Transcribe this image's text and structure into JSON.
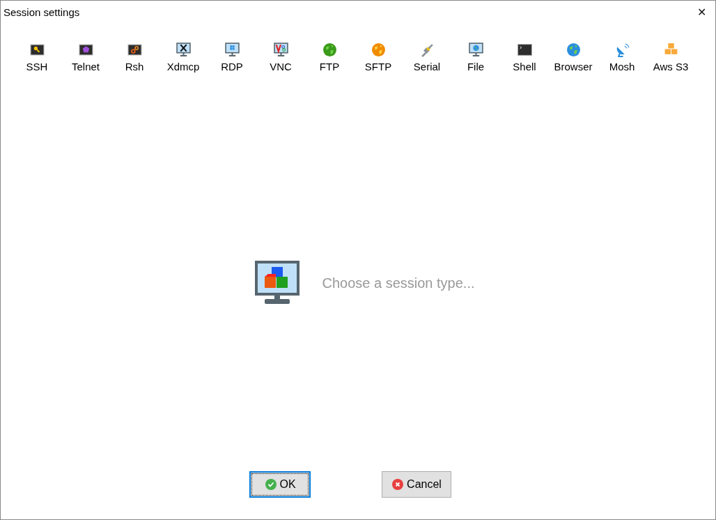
{
  "window": {
    "title": "Session settings",
    "close": "✕"
  },
  "session_types": [
    {
      "label": "SSH",
      "kind": "key"
    },
    {
      "label": "Telnet",
      "kind": "gem"
    },
    {
      "label": "Rsh",
      "kind": "gears"
    },
    {
      "label": "Xdmcp",
      "kind": "xmonitor"
    },
    {
      "label": "RDP",
      "kind": "winmonitor"
    },
    {
      "label": "VNC",
      "kind": "vncmonitor"
    },
    {
      "label": "FTP",
      "kind": "greenglobe"
    },
    {
      "label": "SFTP",
      "kind": "orangeglobe"
    },
    {
      "label": "Serial",
      "kind": "plug"
    },
    {
      "label": "File",
      "kind": "globemonitor"
    },
    {
      "label": "Shell",
      "kind": "terminal"
    },
    {
      "label": "Browser",
      "kind": "blueglobe"
    },
    {
      "label": "Mosh",
      "kind": "dish"
    },
    {
      "label": "Aws S3",
      "kind": "boxes"
    }
  ],
  "placeholder_message": "Choose a session type...",
  "buttons": [
    {
      "label": "OK",
      "kind": "ok",
      "focused": true
    },
    {
      "label": "Cancel",
      "kind": "cancel",
      "focused": false
    }
  ]
}
